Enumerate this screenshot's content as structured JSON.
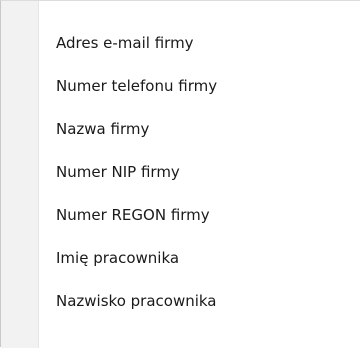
{
  "menu": {
    "items": [
      {
        "label": "Adres e-mail firmy"
      },
      {
        "label": "Numer telefonu firmy"
      },
      {
        "label": "Nazwa firmy"
      },
      {
        "label": "Numer NIP firmy"
      },
      {
        "label": "Numer REGON firmy"
      },
      {
        "label": "Imię pracownika"
      },
      {
        "label": "Nazwisko pracownika"
      }
    ]
  }
}
